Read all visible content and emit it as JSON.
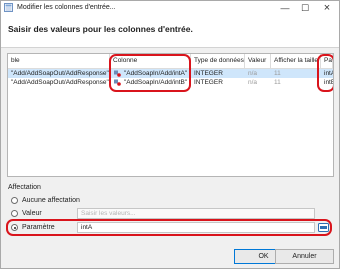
{
  "window": {
    "title": "Modifier les colonnes d'entrée..."
  },
  "header": {
    "heading": "Saisir des valeurs pour les colonnes d'entrée."
  },
  "table": {
    "columns": [
      "ble",
      "Colonne",
      "Type de données",
      "Valeur",
      "Afficher la taille",
      "Parame"
    ],
    "rows": [
      {
        "table": "\"Add/AddSoapOut/AddResponse\"",
        "column": "\"AddSoapIn/Add/intA\"",
        "type": "INTEGER",
        "value": "n/a",
        "size": "11",
        "param": "intA"
      },
      {
        "table": "\"Add/AddSoapOut/AddResponse\"",
        "column": "\"AddSoapIn/Add/intB\"",
        "type": "INTEGER",
        "value": "n/a",
        "size": "11",
        "param": "intB"
      }
    ]
  },
  "affectation": {
    "label": "Affectation",
    "options": {
      "none": "Aucune affectation",
      "value": "Valeur",
      "param": "Paramètre"
    },
    "selected": "param",
    "value_placeholder": "Saisir les valeurs...",
    "param_value": "intA"
  },
  "buttons": {
    "ok": "OK",
    "cancel": "Annuler"
  },
  "colors": {
    "highlight": "#d9141c",
    "selection": "#cfe6fb"
  }
}
